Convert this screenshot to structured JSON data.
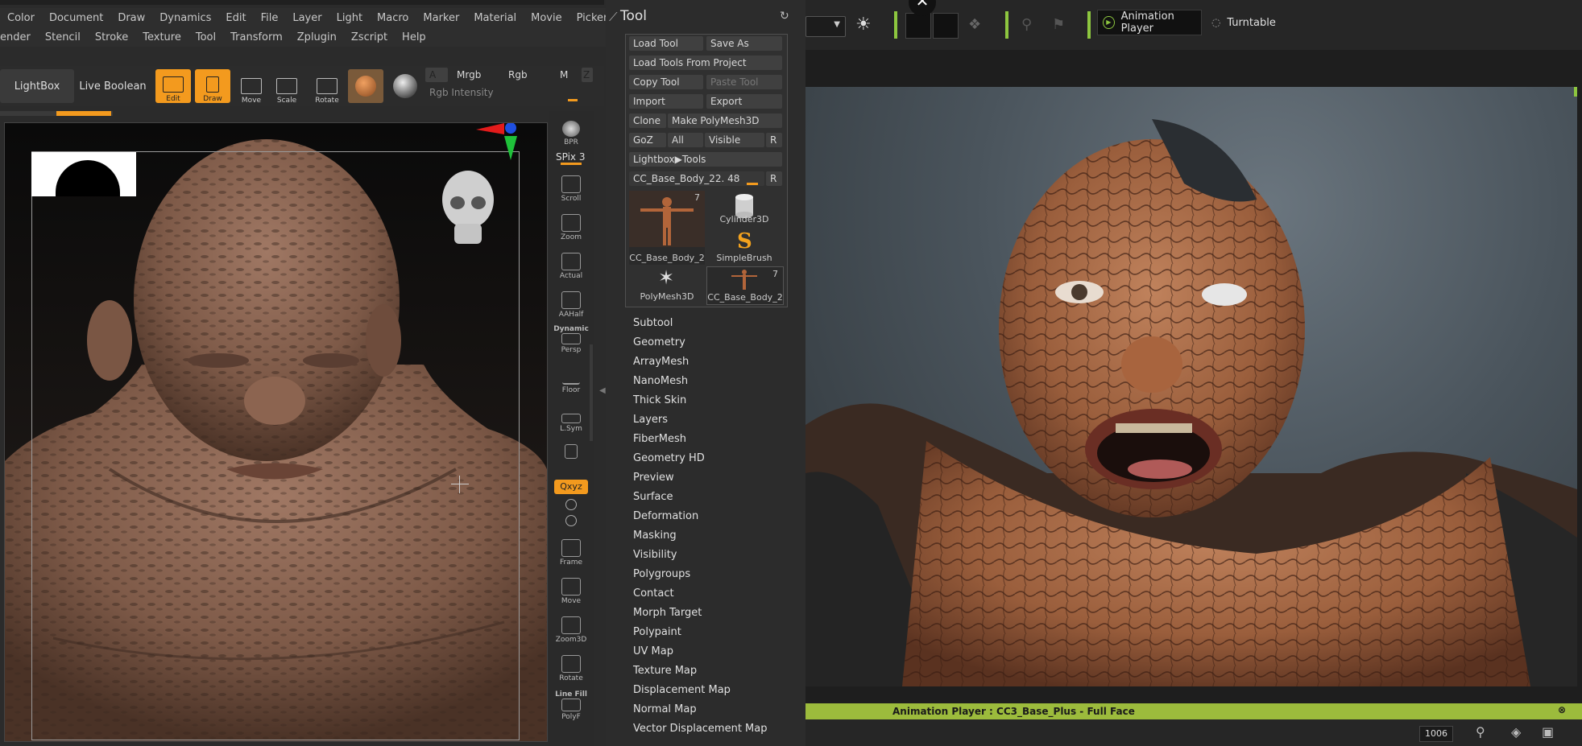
{
  "zbrush": {
    "menu1": [
      "Color",
      "Document",
      "Draw",
      "Dynamics",
      "Edit",
      "File",
      "Layer",
      "Light",
      "Macro",
      "Marker",
      "Material",
      "Movie",
      "Picker"
    ],
    "menu2": [
      "ender",
      "Stencil",
      "Stroke",
      "Texture",
      "Tool",
      "Transform",
      "Zplugin",
      "Zscript",
      "Help"
    ],
    "toolbar": {
      "lightbox": "LightBox",
      "live_boolean": "Live Boolean",
      "edit": "Edit",
      "draw": "Draw",
      "move": "Move",
      "scale": "Scale",
      "rotate": "Rotate",
      "a": "A",
      "mrgb": "Mrgb",
      "rgb": "Rgb",
      "m": "M",
      "z": "Z",
      "rgb_intensity": "Rgb Intensity"
    },
    "shelf": {
      "bpr": "BPR",
      "spix": "SPix 3",
      "scroll": "Scroll",
      "zoom": "Zoom",
      "actual": "Actual",
      "aahalf": "AAHalf",
      "dynamic": "Dynamic",
      "persp": "Persp",
      "floor": "Floor",
      "lsym": "L.Sym",
      "xyz": "Qxyz",
      "frame": "Frame",
      "move": "Move",
      "zoom3d": "Zoom3D",
      "rotate": "Rotate",
      "linefill": "Line Fill",
      "polyf": "PolyF"
    },
    "tool": {
      "title": "Tool",
      "load_tool": "Load Tool",
      "save_as": "Save As",
      "load_from_project": "Load Tools From Project",
      "copy_tool": "Copy Tool",
      "paste_tool": "Paste Tool",
      "import": "Import",
      "export": "Export",
      "clone": "Clone",
      "make_polymesh": "Make PolyMesh3D",
      "goz": "GoZ",
      "all": "All",
      "visible": "Visible",
      "r": "R",
      "lightbox_tools": "Lightbox▶Tools",
      "current_tool": "CC_Base_Body_22. 48",
      "thumbs": [
        {
          "label": "CC_Base_Body_2",
          "count": "7"
        },
        {
          "label": "Cylinder3D",
          "count": ""
        },
        {
          "label": "SimpleBrush",
          "count": ""
        },
        {
          "label": "PolyMesh3D",
          "count": ""
        },
        {
          "label": "CC_Base_Body_2",
          "count": "7"
        }
      ],
      "subpalettes": [
        "Subtool",
        "Geometry",
        "ArrayMesh",
        "NanoMesh",
        "Thick Skin",
        "Layers",
        "FiberMesh",
        "Geometry HD",
        "Preview",
        "Surface",
        "Deformation",
        "Masking",
        "Visibility",
        "Polygroups",
        "Contact",
        "Morph Target",
        "Polypaint",
        "UV Map",
        "Texture Map",
        "Displacement Map",
        "Normal Map",
        "Vector Displacement Map"
      ]
    }
  },
  "cc": {
    "animation_player_btn": "Animation Player",
    "turntable_btn": "Turntable",
    "status_bar": "Animation Player : CC3_Base_Plus - Full Face",
    "frame_value": "1006"
  }
}
